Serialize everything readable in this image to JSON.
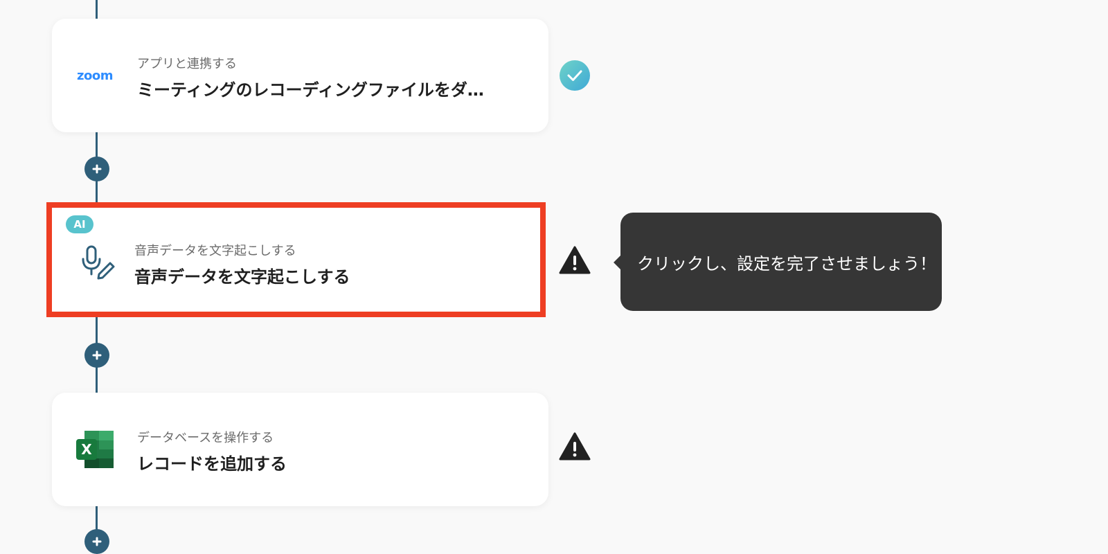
{
  "colors": {
    "flow_line": "#2f5f7a",
    "selected_border": "#ee3e23",
    "success": "#58c3cd",
    "tooltip_bg": "#363636",
    "ai_badge": "#58c3cd"
  },
  "steps": [
    {
      "icon": "zoom-logo",
      "logo_text": "zoom",
      "subtitle": "アプリと連携する",
      "title": "ミーティングのレコーディングファイルをダ…",
      "status": "check-icon"
    },
    {
      "icon": "microphone-pen-icon",
      "badge": "AI",
      "subtitle": "音声データを文字起こしする",
      "title": "音声データを文字起こしする",
      "status": "warning-icon",
      "selected": true
    },
    {
      "icon": "excel-icon",
      "icon_letter": "X",
      "subtitle": "データベースを操作する",
      "title": "レコードを追加する",
      "status": "warning-icon"
    }
  ],
  "tooltip": {
    "text": "クリックし、設定を完了させましょう！"
  }
}
